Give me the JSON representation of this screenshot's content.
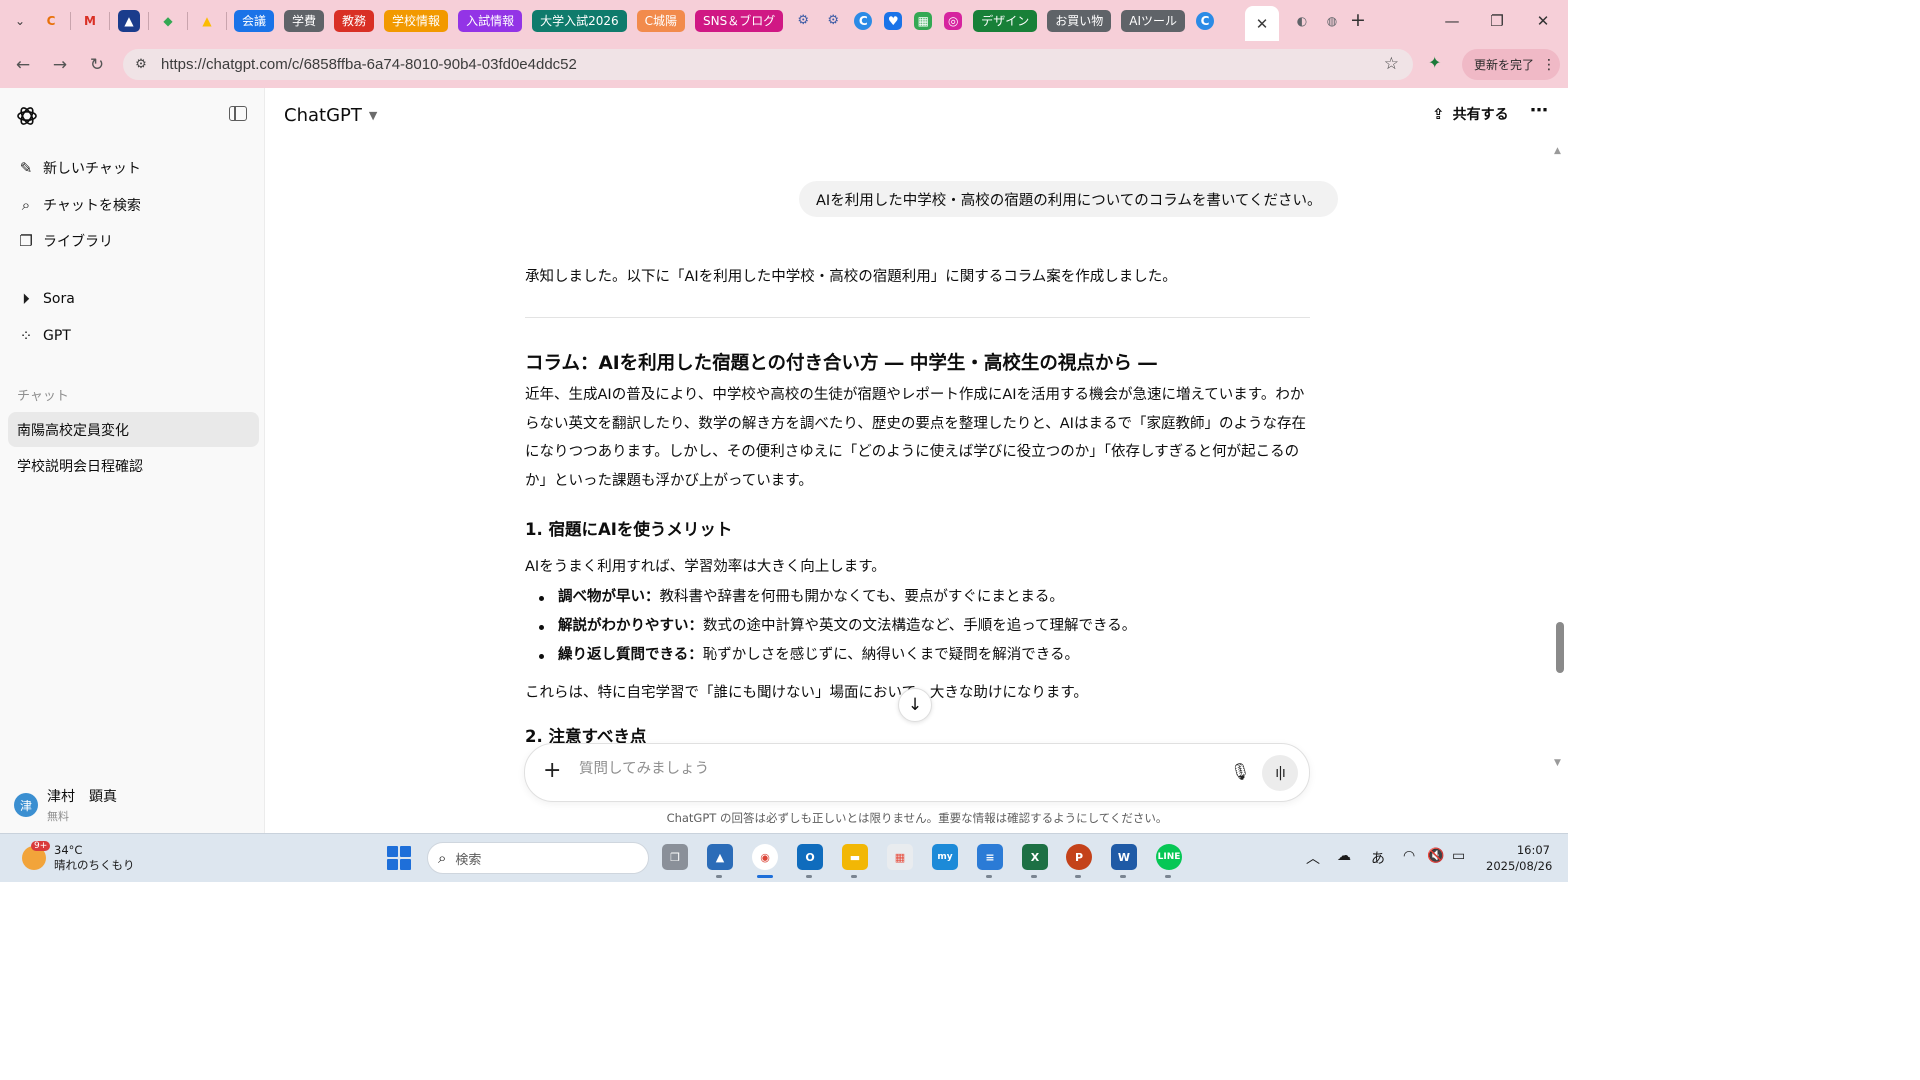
{
  "browser": {
    "bookmarks_chips": [
      {
        "label": "会議",
        "color": "#1a73e8"
      },
      {
        "label": "学費",
        "color": "#5f6368"
      },
      {
        "label": "教務",
        "color": "#d93025"
      },
      {
        "label": "学校情報",
        "color": "#f29900"
      },
      {
        "label": "入試情報",
        "color": "#9334e6"
      },
      {
        "label": "大学入試2026",
        "color": "#0f7b6c"
      },
      {
        "label": "C城陽",
        "color": "#f28b4c"
      },
      {
        "label": "SNS＆ブログ",
        "color": "#d01884"
      },
      {
        "label": "デザイン",
        "color": "#188038"
      },
      {
        "label": "お買い物",
        "color": "#5f6368"
      },
      {
        "label": "AIツール",
        "color": "#5f6368"
      }
    ],
    "url": "https://chatgpt.com/c/6858ffba-6a74-8010-90b4-03fd0e4ddc52",
    "update_label": "更新を完了"
  },
  "sidebar": {
    "items": [
      {
        "label": "新しいチャット",
        "icon": "edit-icon"
      },
      {
        "label": "チャットを検索",
        "icon": "search-icon"
      },
      {
        "label": "ライブラリ",
        "icon": "library-icon"
      },
      {
        "label": "Sora",
        "icon": "play-icon"
      },
      {
        "label": "GPT",
        "icon": "grid-icon"
      }
    ],
    "section_label": "チャット",
    "chats": [
      "南陽高校定員変化",
      "学校説明会日程確認"
    ],
    "user": {
      "initial": "津",
      "name": "津村　顕真",
      "plan": "無料"
    }
  },
  "header": {
    "model": "ChatGPT",
    "share_label": "共有する"
  },
  "conversation": {
    "user_message": "AIを利用した中学校・高校の宿題の利用についてのコラムを書いてください。",
    "answer": {
      "intro": "承知しました。以下に「AIを利用した中学校・高校の宿題利用」に関するコラム案を作成しました。",
      "title": "コラム：AIを利用した宿題との付き合い方 ― 中学生・高校生の視点から ―",
      "para1": "近年、生成AIの普及により、中学校や高校の生徒が宿題やレポート作成にAIを活用する機会が急速に増えています。わからない英文を翻訳したり、数学の解き方を調べたり、歴史の要点を整理したりと、AIはまるで「家庭教師」のような存在になりつつあります。しかし、その便利さゆえに「どのように使えば学びに役立つのか」「依存しすぎると何が起こるのか」といった課題も浮かび上がっています。",
      "section1_title": "1. 宿題にAIを使うメリット",
      "section1_lead": "AIをうまく利用すれば、学習効率は大きく向上します。",
      "bullets": [
        {
          "bold": "調べ物が早い：",
          "text": "教科書や辞書を何冊も開かなくても、要点がすぐにまとまる。"
        },
        {
          "bold": "解説がわかりやすい：",
          "text": "数式の途中計算や英文の文法構造など、手順を追って理解できる。"
        },
        {
          "bold": "繰り返し質問できる：",
          "text": "恥ずかしさを感じずに、納得いくまで疑問を解消できる。"
        }
      ],
      "section1_close": "これらは、特に自宅学習で「誰にも聞けない」場面において、大きな助けになります。",
      "section2_title": "2. 注意すべき点"
    }
  },
  "composer": {
    "placeholder": "質問してみましょう"
  },
  "disclaimer": "ChatGPT の回答は必ずしも正しいとは限りません。重要な情報は確認するようにしてください。",
  "taskbar": {
    "weather_badge": "9+",
    "temperature": "34°C",
    "weather_desc": "晴れのちくもり",
    "search_label": "検索",
    "ime": "あ",
    "time": "16:07",
    "date": "2025/08/26"
  }
}
